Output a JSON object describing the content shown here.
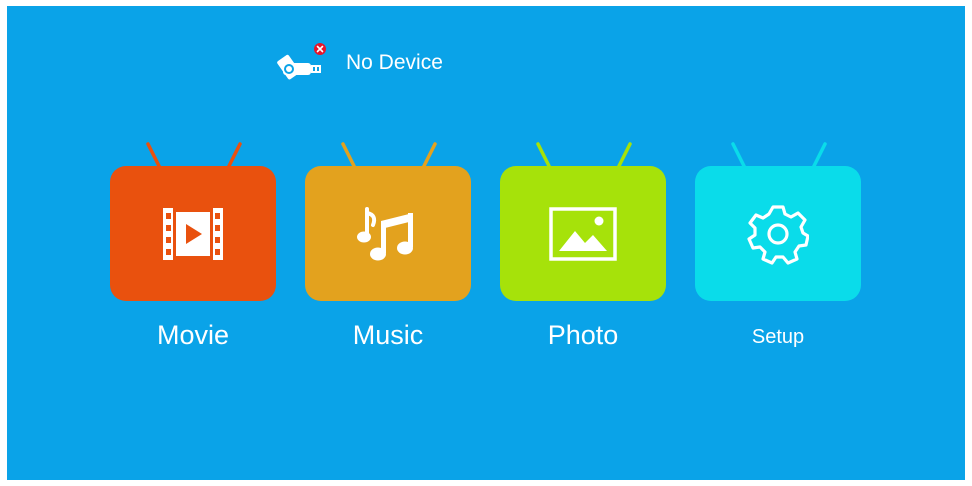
{
  "status": {
    "device_icon": "usb-drive-icon",
    "error_badge_icon": "error-x-icon",
    "text": "No Device"
  },
  "tiles": [
    {
      "label": "Movie",
      "icon": "film-icon",
      "color": "#E9510E"
    },
    {
      "label": "Music",
      "icon": "music-note-icon",
      "color": "#E3A21E"
    },
    {
      "label": "Photo",
      "icon": "picture-icon",
      "color": "#A6E20A"
    },
    {
      "label": "Setup",
      "icon": "gear-icon",
      "color": "#0ADCEA"
    }
  ],
  "colors": {
    "background": "#0AA3E8",
    "frame": "#FFFFFF",
    "badge": "#E8142A"
  }
}
